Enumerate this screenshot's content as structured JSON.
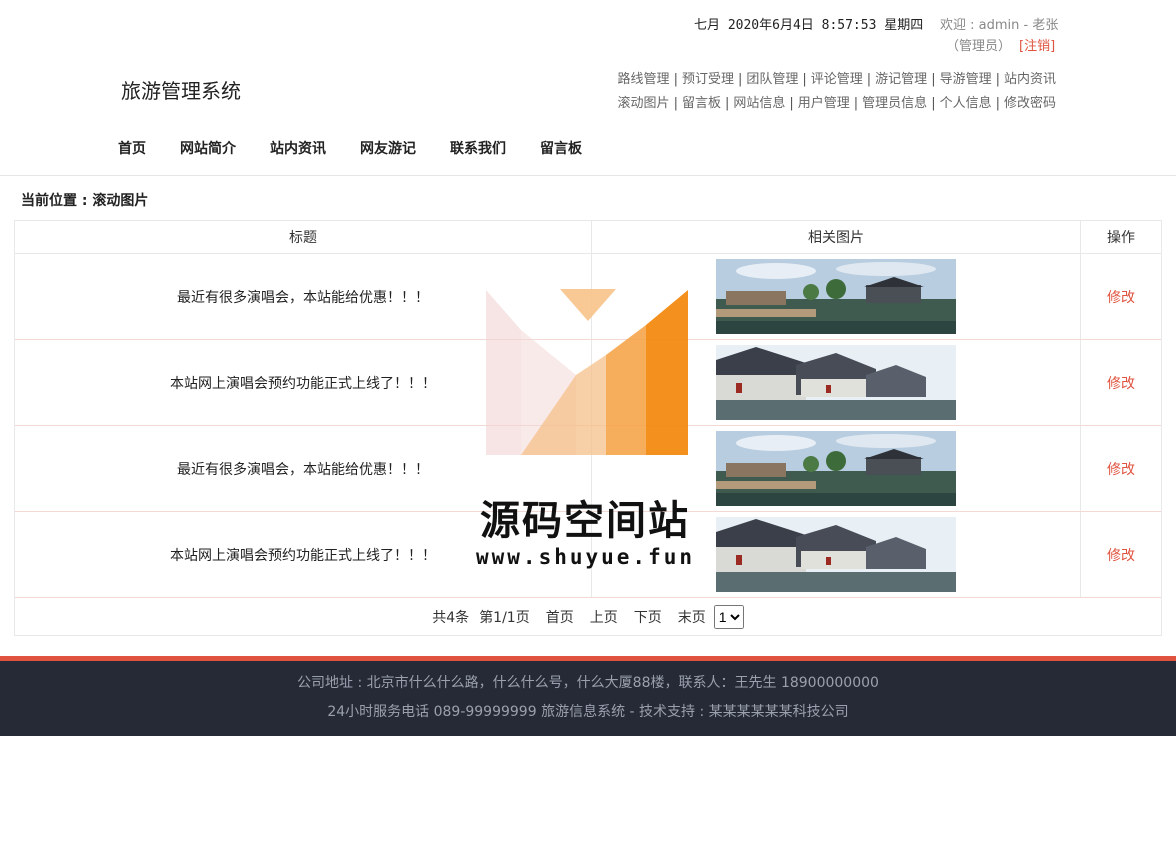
{
  "header": {
    "datetime": "七月 2020年6月4日 8:57:53 星期四",
    "welcome": "欢迎 : admin - 老张",
    "role": "（管理员）",
    "logout_label": "[注销]",
    "site_title": "旅游管理系统",
    "admin_links_row1": [
      "路线管理",
      "预订受理",
      "团队管理",
      "评论管理",
      "游记管理",
      "导游管理",
      "站内资讯"
    ],
    "admin_links_row2": [
      "滚动图片",
      "留言板",
      "网站信息",
      "用户管理",
      "管理员信息",
      "个人信息",
      "修改密码"
    ]
  },
  "nav": [
    "首页",
    "网站简介",
    "站内资讯",
    "网友游记",
    "联系我们",
    "留言板"
  ],
  "breadcrumb": "当前位置 : 滚动图片",
  "table": {
    "headers": [
      "标题",
      "相关图片",
      "操作"
    ],
    "rows": [
      {
        "title": "最近有很多演唱会，本站能给优惠！！！",
        "action": "修改"
      },
      {
        "title": "本站网上演唱会预约功能正式上线了！！！",
        "action": "修改"
      },
      {
        "title": "最近有很多演唱会，本站能给优惠！！！",
        "action": "修改"
      },
      {
        "title": "本站网上演唱会预约功能正式上线了！！！",
        "action": "修改"
      }
    ]
  },
  "pager": {
    "total": "共4条",
    "page": "第1/1页",
    "first": "首页",
    "prev": "上页",
    "next": "下页",
    "last": "末页",
    "selected": "1"
  },
  "watermark": {
    "title": "源码空间站",
    "url": "www.shuyue.fun"
  },
  "footer": {
    "line1": "公司地址 : 北京市什么什么路，什么什么号，什么大厦88楼，联系人：王先生 18900000000",
    "line2": "24小时服务电话   089-99999999   旅游信息系统 - 技术支持 : 某某某某某某科技公司"
  },
  "colors": {
    "accent": "#e0533f",
    "footer_bg": "#262a36"
  }
}
